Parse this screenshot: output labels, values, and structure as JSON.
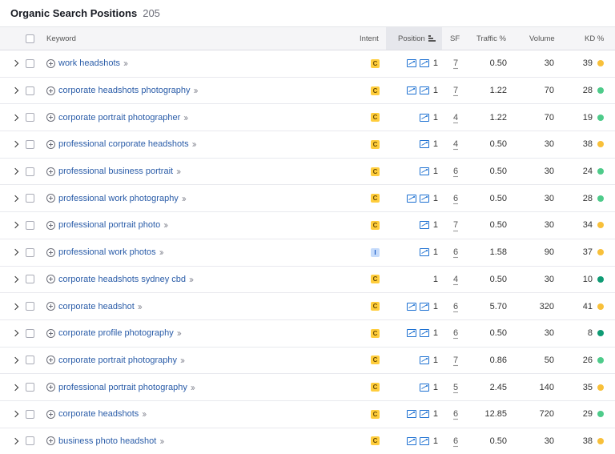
{
  "header": {
    "title": "Organic Search Positions",
    "count": "205"
  },
  "columns": {
    "keyword": "Keyword",
    "intent": "Intent",
    "position": "Position",
    "sf": "SF",
    "traffic": "Traffic %",
    "volume": "Volume",
    "kd": "KD %"
  },
  "colors": {
    "easy_green": "#4ecb8a",
    "medium_yellow": "#f8c03a",
    "very_easy_teal": "#0f9b74"
  },
  "rows": [
    {
      "keyword": "work headshots",
      "intent": "C",
      "serp_icons": 2,
      "position": "1",
      "sf": "7",
      "traffic": "0.50",
      "volume": "30",
      "kd": "39",
      "kd_color": "#f8c03a"
    },
    {
      "keyword": "corporate headshots photography",
      "intent": "C",
      "serp_icons": 2,
      "position": "1",
      "sf": "7",
      "traffic": "1.22",
      "volume": "70",
      "kd": "28",
      "kd_color": "#4ecb8a"
    },
    {
      "keyword": "corporate portrait photographer",
      "intent": "C",
      "serp_icons": 1,
      "position": "1",
      "sf": "4",
      "traffic": "1.22",
      "volume": "70",
      "kd": "19",
      "kd_color": "#4ecb8a"
    },
    {
      "keyword": "professional corporate headshots",
      "intent": "C",
      "serp_icons": 1,
      "position": "1",
      "sf": "4",
      "traffic": "0.50",
      "volume": "30",
      "kd": "38",
      "kd_color": "#f8c03a"
    },
    {
      "keyword": "professional business portrait",
      "intent": "C",
      "serp_icons": 1,
      "position": "1",
      "sf": "6",
      "traffic": "0.50",
      "volume": "30",
      "kd": "24",
      "kd_color": "#4ecb8a"
    },
    {
      "keyword": "professional work photography",
      "intent": "C",
      "serp_icons": 2,
      "position": "1",
      "sf": "6",
      "traffic": "0.50",
      "volume": "30",
      "kd": "28",
      "kd_color": "#4ecb8a"
    },
    {
      "keyword": "professional portrait photo",
      "intent": "C",
      "serp_icons": 1,
      "position": "1",
      "sf": "7",
      "traffic": "0.50",
      "volume": "30",
      "kd": "34",
      "kd_color": "#f8c03a"
    },
    {
      "keyword": "professional work photos",
      "intent": "I",
      "serp_icons": 1,
      "position": "1",
      "sf": "6",
      "traffic": "1.58",
      "volume": "90",
      "kd": "37",
      "kd_color": "#f8c03a"
    },
    {
      "keyword": "corporate headshots sydney cbd",
      "intent": "C",
      "serp_icons": 0,
      "position": "1",
      "sf": "4",
      "traffic": "0.50",
      "volume": "30",
      "kd": "10",
      "kd_color": "#0f9b74"
    },
    {
      "keyword": "corporate headshot",
      "intent": "C",
      "serp_icons": 2,
      "position": "1",
      "sf": "6",
      "traffic": "5.70",
      "volume": "320",
      "kd": "41",
      "kd_color": "#f8c03a"
    },
    {
      "keyword": "corporate profile photography",
      "intent": "C",
      "serp_icons": 2,
      "position": "1",
      "sf": "6",
      "traffic": "0.50",
      "volume": "30",
      "kd": "8",
      "kd_color": "#0f9b74"
    },
    {
      "keyword": "corporate portrait photography",
      "intent": "C",
      "serp_icons": 1,
      "position": "1",
      "sf": "7",
      "traffic": "0.86",
      "volume": "50",
      "kd": "26",
      "kd_color": "#4ecb8a"
    },
    {
      "keyword": "professional portrait photography",
      "intent": "C",
      "serp_icons": 1,
      "position": "1",
      "sf": "5",
      "traffic": "2.45",
      "volume": "140",
      "kd": "35",
      "kd_color": "#f8c03a"
    },
    {
      "keyword": "corporate headshots",
      "intent": "C",
      "serp_icons": 2,
      "position": "1",
      "sf": "6",
      "traffic": "12.85",
      "volume": "720",
      "kd": "29",
      "kd_color": "#4ecb8a"
    },
    {
      "keyword": "business photo headshot",
      "intent": "C",
      "serp_icons": 2,
      "position": "1",
      "sf": "6",
      "traffic": "0.50",
      "volume": "30",
      "kd": "38",
      "kd_color": "#f8c03a"
    }
  ]
}
